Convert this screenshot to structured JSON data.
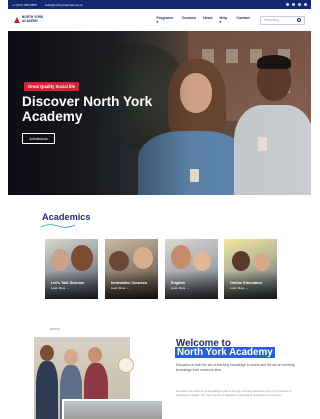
{
  "topbar": {
    "phone": "+1 (647) 555-5555",
    "email": "hello@northyorkacademy.ca"
  },
  "header": {
    "logo_text": "NORTH YORK ACADEMY",
    "nav": [
      {
        "label": "Programs ▾"
      },
      {
        "label": "Courses"
      },
      {
        "label": "News"
      },
      {
        "label": "Help ▾"
      },
      {
        "label": "Contact"
      }
    ],
    "search_placeholder": "Searching"
  },
  "hero": {
    "tag": "Great Quality Social life",
    "title": "Discover North York Academy",
    "button": "Admissions"
  },
  "academics": {
    "title": "Academics",
    "cards": [
      {
        "label": "Let's Talk Science",
        "more": "Learn More →"
      },
      {
        "label": "Innovative Courses",
        "more": "Learn More →"
      },
      {
        "label": "English",
        "more": "Learn More →"
      },
      {
        "label": "Online Education",
        "more": "Learn More →"
      }
    ]
  },
  "welcome": {
    "line1": "Welcome to",
    "line2": "North York Academy",
    "intro": "Education is both the act of teaching knowledge to others and the act of receiving knowledge from someone else.",
    "paragraph": "Education also refers to the knowledge received through schooling instruction and to the institution of teaching as a whole. The main purpose of education is the integral development of a person."
  },
  "colors": {
    "brand_navy": "#1c2b5e",
    "accent_red": "#d6233a",
    "highlight_blue": "#2b5fd6"
  }
}
